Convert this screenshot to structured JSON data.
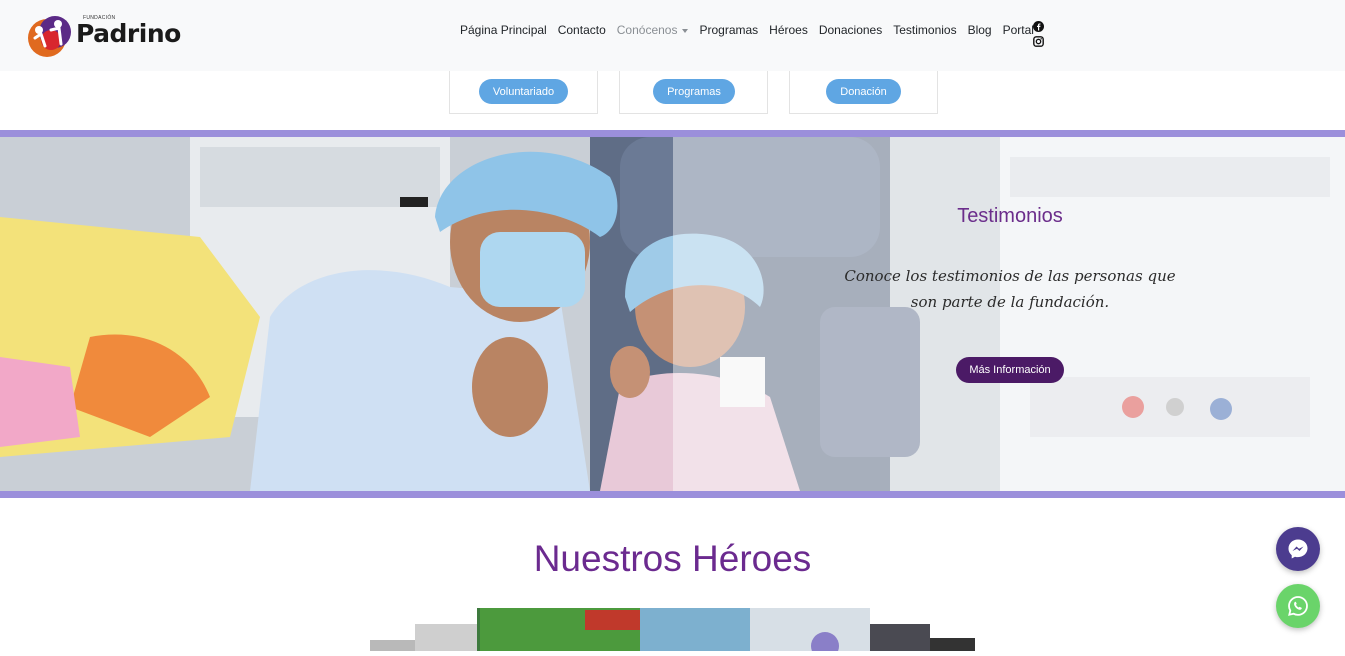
{
  "brand": {
    "small_text": "FUNDACIÓN",
    "name": "Padrino"
  },
  "nav": {
    "items": [
      {
        "label": "Página Principal"
      },
      {
        "label": "Contacto"
      },
      {
        "label": "Conócenos"
      },
      {
        "label": "Programas"
      },
      {
        "label": "Héroes"
      },
      {
        "label": "Donaciones"
      },
      {
        "label": "Testimonios"
      },
      {
        "label": "Blog"
      },
      {
        "label": "Portal"
      }
    ],
    "social": [
      "facebook-icon",
      "instagram-icon"
    ]
  },
  "cards": [
    {
      "button": "Voluntariado"
    },
    {
      "button": "Programas"
    },
    {
      "button": "Donación"
    }
  ],
  "hero": {
    "title": "Testimonios",
    "description": "Conoce los testimonios de las personas que son parte de la fundación.",
    "button": "Más Información"
  },
  "section": {
    "title": "Nuestros Héroes"
  },
  "colors": {
    "accent_purple": "#6b2a8f",
    "button_blue": "#5fa6e3",
    "hero_border": "#9b8fdb",
    "messenger": "#4c3c8f",
    "whatsapp": "#6ad46a"
  },
  "floating": [
    "messenger-icon",
    "whatsapp-icon"
  ]
}
